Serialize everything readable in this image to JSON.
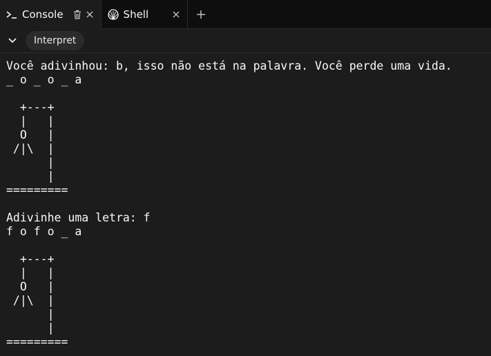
{
  "tabs": [
    {
      "label": "Console",
      "icon": "terminal-icon",
      "active": true
    },
    {
      "label": "Shell",
      "icon": "shell-icon",
      "active": false
    }
  ],
  "toolbar": {
    "interpret_label": "Interpret"
  },
  "console": {
    "lines": [
      "Você adivinhou: b, isso não está na palavra. Você perde uma vida.",
      "_ o _ o _ a",
      "",
      "  +---+",
      "  |   |",
      "  O   |",
      " /|\\  |",
      "      |",
      "      |",
      "=========",
      "",
      "Adivinhe uma letra: f",
      "f o f o _ a",
      "",
      "  +---+",
      "  |   |",
      "  O   |",
      " /|\\  |",
      "      |",
      "      |",
      "========="
    ]
  },
  "colors": {
    "background": "#1c1c1c",
    "tabbar_background": "#0e0e0e",
    "text": "#f5f9fc",
    "button_background": "#2b2b2b"
  }
}
